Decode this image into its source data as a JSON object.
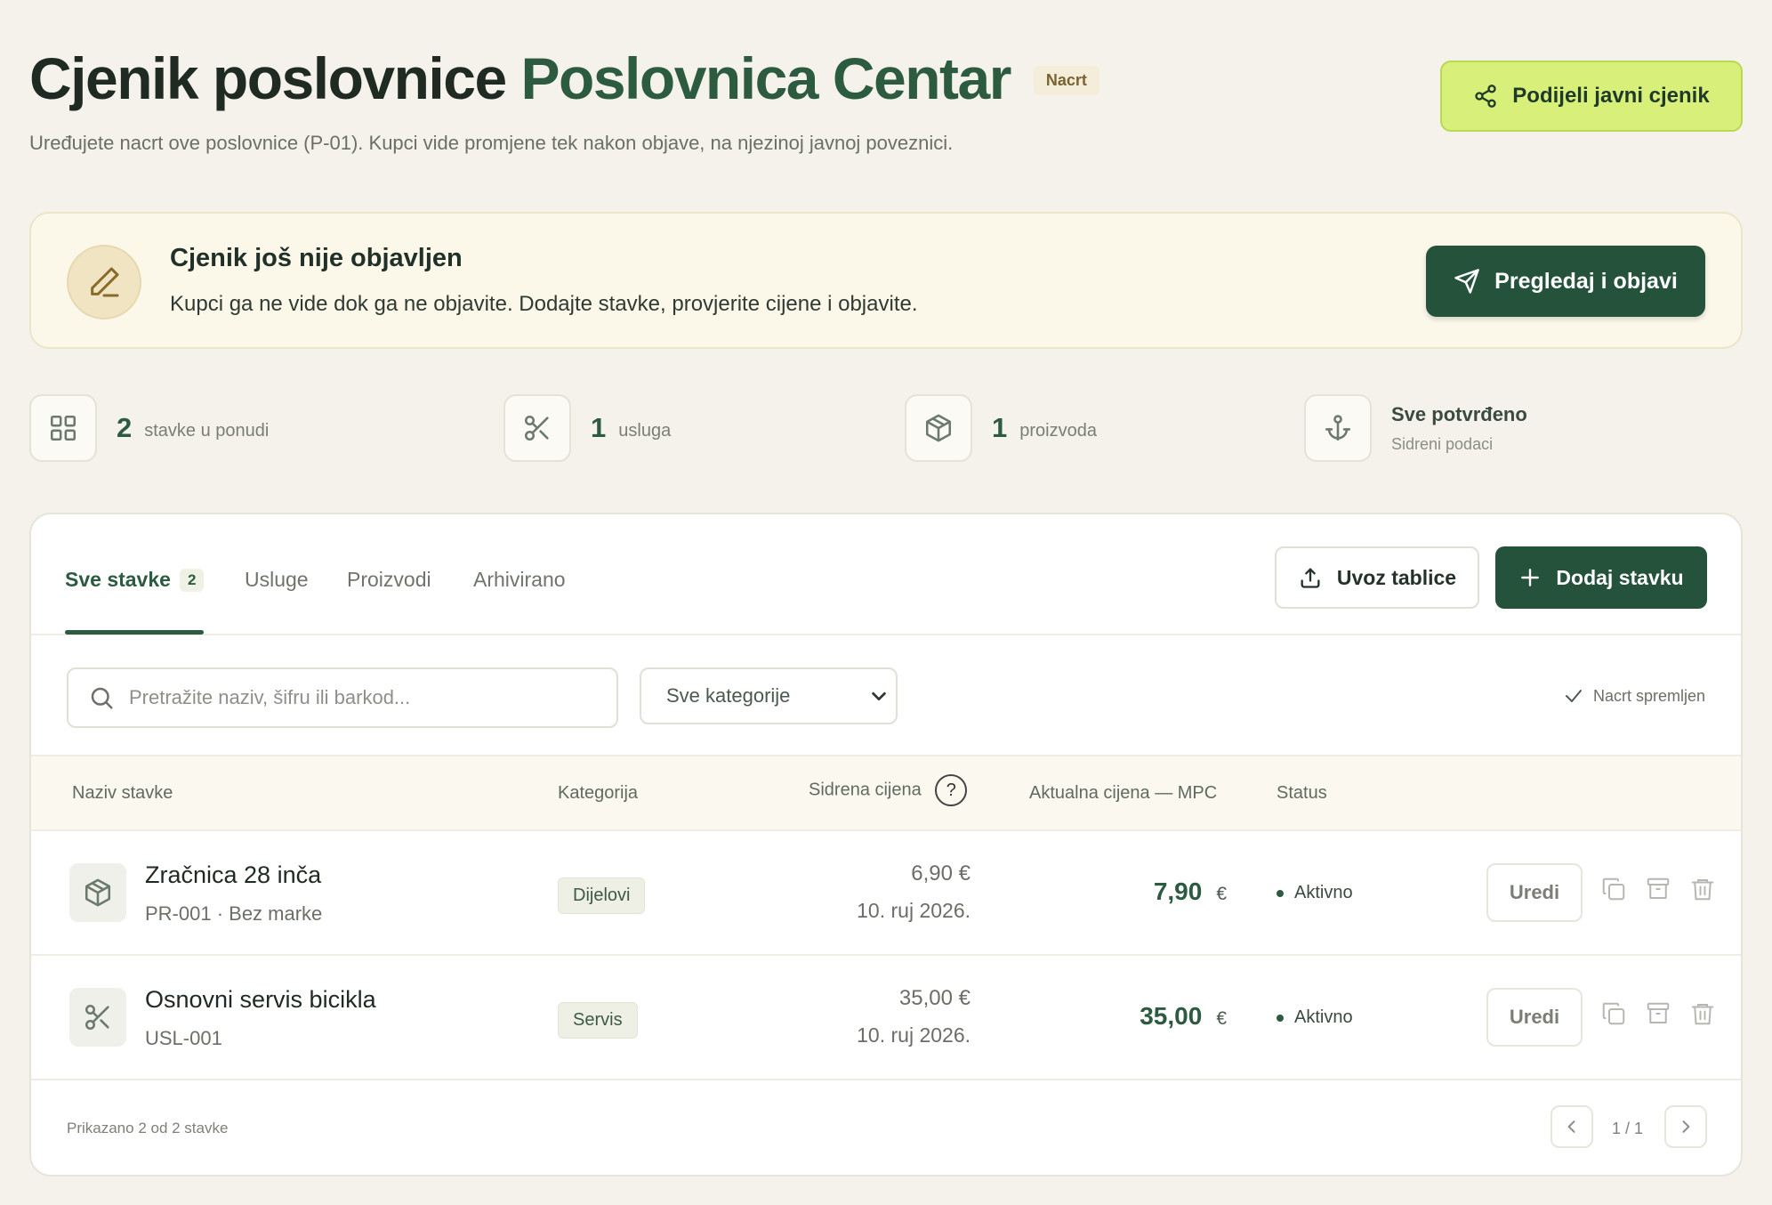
{
  "header": {
    "title_main": "Cjenik poslovnice",
    "title_accent": "Poslovnica Centar",
    "status_badge": "Nacrt",
    "subtitle": "Uređujete nacrt ove poslovnice (P-01). Kupci vide promjene tek nakon objave, na njezinoj javnoj poveznici.",
    "share_label": "Podijeli javni cjenik"
  },
  "banner": {
    "title": "Cjenik još nije objavljen",
    "text": "Kupci ga ne vide dok ga ne objavite. Dodajte stavke, provjerite cijene i objavite.",
    "publish_label": "Pregledaj i objavi"
  },
  "stats": [
    {
      "icon": "grid-icon",
      "value": "2",
      "label": "stavke u ponudi"
    },
    {
      "icon": "scissors-icon",
      "value": "1",
      "label": "usluga"
    },
    {
      "icon": "box-icon",
      "value": "1",
      "label": "proizvoda"
    },
    {
      "icon": "anchor-icon",
      "title": "Sve potvrđeno",
      "label": "Sidreni podaci"
    }
  ],
  "tabs": [
    {
      "label": "Sve stavke",
      "count": "2"
    },
    {
      "label": "Usluge"
    },
    {
      "label": "Proizvodi"
    },
    {
      "label": "Arhivirano"
    }
  ],
  "toolbar": {
    "import_label": "Uvoz tablice",
    "add_label": "Dodaj stavku"
  },
  "filters": {
    "search_placeholder": "Pretražite naziv, šifru ili barkod...",
    "category_selected": "Sve kategorije",
    "saved_label": "Nacrt spremljen"
  },
  "table": {
    "columns": [
      "Naziv stavke",
      "Kategorija",
      "Sidrena cijena",
      "Aktualna cijena — MPC",
      "Status"
    ],
    "help_glyph": "?",
    "edit_label": "Uredi",
    "rows": [
      {
        "icon": "box-icon",
        "name": "Zračnica 28 inča",
        "sub": "PR-001 · Bez marke",
        "category": "Dijelovi",
        "anchor_price": "6,90 €",
        "anchor_date": "10. ruj 2026.",
        "price": "7,90",
        "currency": "€",
        "status": "Aktivno"
      },
      {
        "icon": "scissors-icon",
        "name": "Osnovni servis bicikla",
        "sub": "USL-001",
        "category": "Servis",
        "anchor_price": "35,00 €",
        "anchor_date": "10. ruj 2026.",
        "price": "35,00",
        "currency": "€",
        "status": "Aktivno"
      }
    ]
  },
  "footer": {
    "summary": "Prikazano 2 od 2 stavke",
    "page": "1 / 1"
  },
  "colors": {
    "brand": "#24523b",
    "accent_green": "#2d5b40",
    "lime": "#d8ef7a",
    "background": "#f4f2ea"
  }
}
